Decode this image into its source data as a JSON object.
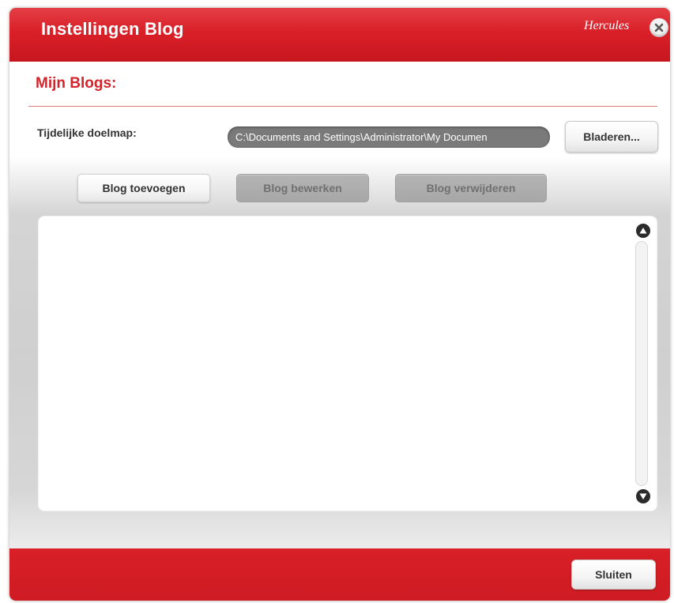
{
  "window": {
    "title": "Instellingen Blog",
    "brand": "Hercules",
    "close_icon": "close-x-circle"
  },
  "section": {
    "title": "Mijn Blogs:"
  },
  "destination": {
    "label": "Tijdelijke doelmap:",
    "path_value": "C:\\Documents and Settings\\Administrator\\My Documen",
    "browse_label": "Bladeren..."
  },
  "toolbar": {
    "add_label": "Blog toevoegen",
    "edit_label": "Blog bewerken",
    "delete_label": "Blog verwijderen"
  },
  "blog_list": {
    "items": []
  },
  "footer": {
    "close_label": "Sluiten"
  },
  "colors": {
    "brand_red": "#d81f27",
    "heading_red": "#d4232a",
    "path_field_bg": "#7a7a7a",
    "disabled_button": "#b0b0b0"
  }
}
